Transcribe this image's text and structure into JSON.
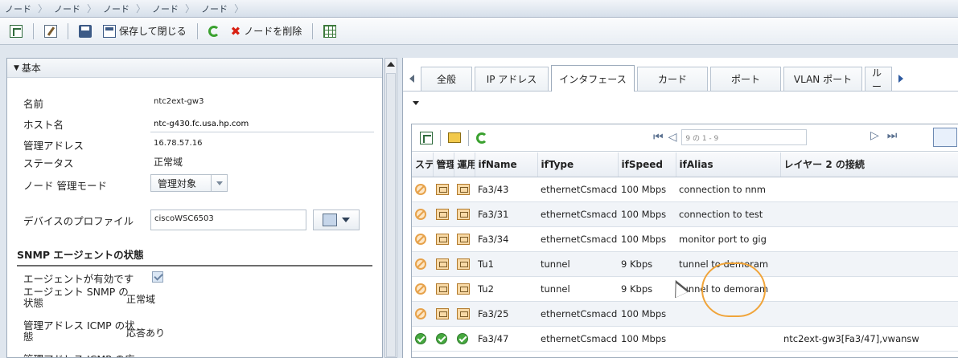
{
  "breadcrumb": [
    "ノード",
    "ノード",
    "ノード",
    "ノード",
    "ノード"
  ],
  "toolbar": {
    "save_close_label": "保存して閉じる",
    "delete_label": "ノードを削除"
  },
  "left": {
    "section_title": "基本",
    "name_label": "名前",
    "name_value": "ntc2ext-gw3",
    "hostname_label": "ホスト名",
    "hostname_value": "ntc-g430.fc.usa.hp.com",
    "mgmt_addr_label": "管理アドレス",
    "mgmt_addr_value": "16.78.57.16",
    "status_label": "ステータス",
    "status_value": "正常域",
    "mgmt_mode_label": "ノード 管理モード",
    "mgmt_mode_value": "管理対象",
    "device_profile_label": "デバイスのプロファイル",
    "device_profile_value": "ciscoWSC6503",
    "snmp_section_title": "SNMP エージェントの状態",
    "agent_enabled_label": "エージェントが有効です",
    "agent_snmp_status_label": "エージェント SNMP の状態",
    "agent_snmp_status_value": "正常域",
    "mgmt_icmp_label": "管理アドレス ICMP の状態",
    "mgmt_icmp_value": "応答あり",
    "mgmt_icmp_next_label": "管理アドレス ICMP の応"
  },
  "tabs": [
    "全般",
    "IP アドレス",
    "インタフェース",
    "カード",
    "ポート",
    "VLAN ポート",
    "ルー"
  ],
  "active_tab": "インタフェース",
  "pager_text": "9 の 1 - 9",
  "table": {
    "columns": [
      "ステ",
      "管理",
      "運用",
      "ifName",
      "ifType",
      "ifSpeed",
      "ifAlias",
      "レイヤー 2 の接続"
    ],
    "rows": [
      {
        "status": "nopoll",
        "ifName": "Fa3/43",
        "ifType": "ethernetCsmacd",
        "ifSpeed": "100 Mbps",
        "ifAlias": "connection to nnm",
        "l2": ""
      },
      {
        "status": "nopoll",
        "ifName": "Fa3/31",
        "ifType": "ethernetCsmacd",
        "ifSpeed": "100 Mbps",
        "ifAlias": "connection to test",
        "l2": ""
      },
      {
        "status": "nopoll",
        "ifName": "Fa3/34",
        "ifType": "ethernetCsmacd",
        "ifSpeed": "100 Mbps",
        "ifAlias": "monitor port to gig",
        "l2": ""
      },
      {
        "status": "nopoll",
        "ifName": "Tu1",
        "ifType": "tunnel",
        "ifSpeed": "9 Kbps",
        "ifAlias": "tunnel to demoram",
        "l2": ""
      },
      {
        "status": "nopoll",
        "ifName": "Tu2",
        "ifType": "tunnel",
        "ifSpeed": "9 Kbps",
        "ifAlias": "tunnel to demoram",
        "l2": ""
      },
      {
        "status": "nopoll",
        "ifName": "Fa3/25",
        "ifType": "ethernetCsmacd",
        "ifSpeed": "100 Mbps",
        "ifAlias": "",
        "l2": ""
      },
      {
        "status": "normal",
        "ifName": "Fa3/47",
        "ifType": "ethernetCsmacd",
        "ifSpeed": "100 Mbps",
        "ifAlias": "",
        "l2": "ntc2ext-gw3[Fa3/47],vwansw"
      }
    ]
  }
}
